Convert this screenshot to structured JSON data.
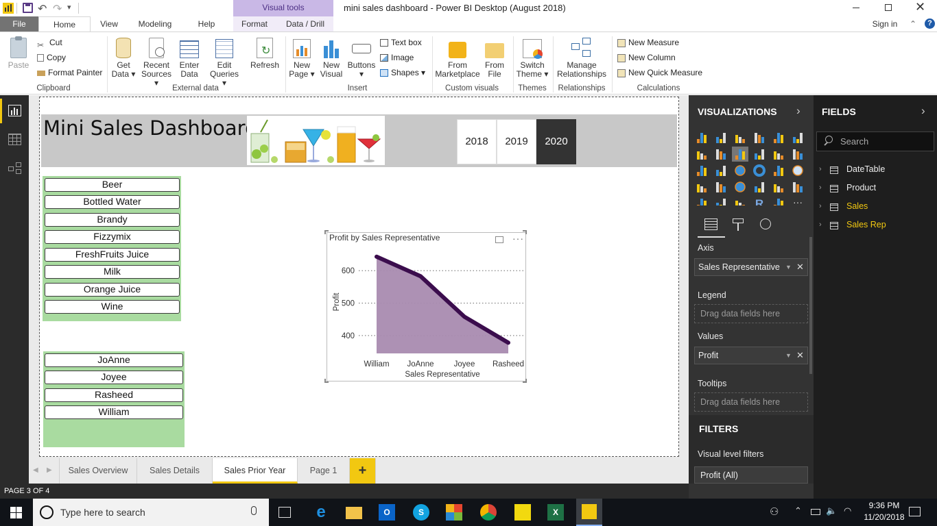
{
  "window": {
    "title": "mini sales dashboard - Power BI Desktop (August 2018)",
    "contextual_tab_group": "Visual tools"
  },
  "ribbon_tabs": [
    "File",
    "Home",
    "View",
    "Modeling",
    "Help",
    "Format",
    "Data / Drill"
  ],
  "sign_in": "Sign in",
  "ribbon": {
    "clipboard": {
      "paste": "Paste",
      "cut": "Cut",
      "copy": "Copy",
      "format_painter": "Format Painter",
      "label": "Clipboard"
    },
    "external_data": {
      "get_data": [
        "Get",
        "Data ▾"
      ],
      "recent_sources": [
        "Recent",
        "Sources ▾"
      ],
      "enter_data": [
        "Enter",
        "Data"
      ],
      "edit_queries": [
        "Edit",
        "Queries ▾"
      ],
      "refresh": "Refresh",
      "label": "External data"
    },
    "insert": {
      "new_page": [
        "New",
        "Page ▾"
      ],
      "new_visual": [
        "New",
        "Visual"
      ],
      "buttons": [
        "Buttons",
        "▾"
      ],
      "text_box": "Text box",
      "image": "Image",
      "shapes": "Shapes ▾",
      "label": "Insert"
    },
    "custom_visuals": {
      "from_marketplace": [
        "From",
        "Marketplace"
      ],
      "from_file": [
        "From",
        "File"
      ],
      "label": "Custom visuals"
    },
    "themes": {
      "switch_theme": [
        "Switch",
        "Theme ▾"
      ],
      "label": "Themes"
    },
    "relationships": {
      "manage": [
        "Manage",
        "Relationships"
      ],
      "label": "Relationships"
    },
    "calculations": {
      "new_measure": "New Measure",
      "new_column": "New Column",
      "new_quick_measure": "New Quick Measure",
      "label": "Calculations"
    }
  },
  "report": {
    "title": "Mini Sales Dashboard",
    "year_buttons": [
      {
        "label": "2018",
        "selected": false
      },
      {
        "label": "2019",
        "selected": false
      },
      {
        "label": "2020",
        "selected": true
      }
    ],
    "product_slicer": [
      "Beer",
      "Bottled Water",
      "Brandy",
      "Fizzymix",
      "FreshFruits Juice",
      "Milk",
      "Orange Juice",
      "Wine"
    ],
    "rep_slicer": [
      "JoAnne",
      "Joyee",
      "Rasheed",
      "William"
    ]
  },
  "chart_data": {
    "type": "area",
    "title": "Profit by Sales Representative",
    "xlabel": "Sales Representative",
    "ylabel": "Profit",
    "categories": [
      "William",
      "JoAnne",
      "Joyee",
      "Rasheed"
    ],
    "series": [
      {
        "values": [
          643,
          583,
          458,
          378
        ]
      }
    ],
    "yticks": [
      400,
      500,
      600
    ],
    "ylim": [
      345,
      670
    ],
    "grid": true,
    "line_color": "#3b0d4d",
    "fill_color": "#a98bb0"
  },
  "page_tabs": [
    {
      "label": "Sales Overview",
      "active": false
    },
    {
      "label": "Sales Details",
      "active": false
    },
    {
      "label": "Sales Prior Year",
      "active": true
    },
    {
      "label": "Page 1",
      "active": false
    }
  ],
  "add_page_label": "+",
  "status": "PAGE 3 OF 4",
  "visualizations": {
    "header": "VISUALIZATIONS",
    "axis_label": "Axis",
    "axis_field": "Sales Representative",
    "legend_label": "Legend",
    "legend_placeholder": "Drag data fields here",
    "values_label": "Values",
    "values_field": "Profit",
    "tooltips_label": "Tooltips",
    "tooltips_placeholder": "Drag data fields here",
    "filters_header": "FILTERS",
    "visual_level_filters": "Visual level filters",
    "filter_item": "Profit  (All)"
  },
  "fields": {
    "header": "FIELDS",
    "search_placeholder": "Search",
    "tables": [
      {
        "name": "DateTable",
        "highlight": false
      },
      {
        "name": "Product",
        "highlight": false
      },
      {
        "name": "Sales",
        "highlight": true
      },
      {
        "name": "Sales Rep",
        "highlight": true
      }
    ]
  },
  "taskbar": {
    "search_placeholder": "Type here to search",
    "time": "9:36 PM",
    "date": "11/20/2018"
  },
  "colors": {
    "accent_yellow": "#f2c811",
    "field_highlight": "#f2c811",
    "slicer_bg": "#a9dba0",
    "header_band": "#c8c8c8",
    "year_selected": "#333333"
  }
}
